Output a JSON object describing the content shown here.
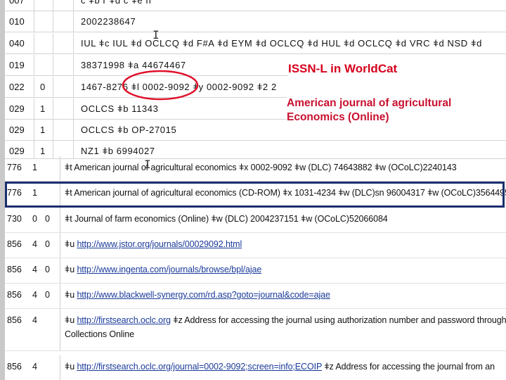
{
  "upper_rows": [
    {
      "tag": "007",
      "i1": "",
      "i2": "",
      "value": "c ǂb r ǂd c ǂe n"
    },
    {
      "tag": "010",
      "i1": "",
      "i2": "",
      "value": "2002238647"
    },
    {
      "tag": "040",
      "i1": "",
      "i2": "",
      "value": "IUL ǂc IUL ǂd OCLCQ ǂd F#A ǂd EYM ǂd OCLCQ ǂd HUL ǂd OCLCQ ǂd VRC ǂd NSD ǂd"
    },
    {
      "tag": "019",
      "i1": "",
      "i2": "",
      "value": "38371998 ǂa 44674467"
    },
    {
      "tag": "022",
      "i1": "0",
      "i2": "",
      "value": "1467-8276 ǂl 0002-9092 ǂy 0002-9092 ǂ2 2"
    },
    {
      "tag": "029",
      "i1": "1",
      "i2": "",
      "value": "OCLCS ǂb 11343"
    },
    {
      "tag": "029",
      "i1": "1",
      "i2": "",
      "value": "OCLCS ǂb OP-27015"
    },
    {
      "tag": "029",
      "i1": "1",
      "i2": "",
      "value": "NZ1 ǂb 6994027"
    }
  ],
  "lower_rows": [
    {
      "tag": "776",
      "i1": "1",
      "i2": "",
      "value": "ǂt American journal of agricultural economics ǂx 0002-9092 ǂw (DLC)   74643882 ǂw (OCoLC)2240143"
    },
    {
      "tag": "776",
      "i1": "1",
      "i2": "",
      "value": "ǂt American journal of agricultural economics (CD-ROM) ǂx 1031-4234 ǂw (DLC)sn 96004317 ǂw (OCoLC)35644954"
    },
    {
      "tag": "730",
      "i1": "0",
      "i2": "0",
      "value": "ǂt Journal of farm economics (Online) ǂw (DLC)   2004237151 ǂw (OCoLC)52066084"
    },
    {
      "tag": "856",
      "i1": "4",
      "i2": "0",
      "prefix": "ǂu ",
      "link": "http://www.jstor.org/journals/00029092.html",
      "suffix": "",
      "cont": ""
    },
    {
      "tag": "856",
      "i1": "4",
      "i2": "0",
      "prefix": "ǂu ",
      "link": "http://www.ingenta.com/journals/browse/bpl/ajae",
      "suffix": "",
      "cont": ""
    },
    {
      "tag": "856",
      "i1": "4",
      "i2": "0",
      "prefix": "ǂu ",
      "link": "http://www.blackwell-synergy.com/rd.asp?goto=journal&code=ajae",
      "suffix": "",
      "cont": ""
    },
    {
      "tag": "856",
      "i1": "4",
      "i2": "",
      "prefix": "ǂu ",
      "link": "http://firstsearch.oclc.org",
      "suffix": " ǂz Address for accessing the journal using authorization number and password through",
      "cont": "Collections Online"
    },
    {
      "tag": "856",
      "i1": "4",
      "i2": "",
      "prefix": "ǂu ",
      "link": "http://firstsearch.oclc.org/journal=0002-9092;screen=info;ECOIP",
      "suffix": " ǂz Address for accessing the journal from an",
      "cont": ""
    }
  ],
  "callouts": {
    "issn_l": "ISSN-L  in WorldCat",
    "title_line1": "American journal of agricultural",
    "title_line2": "Economics (Online)"
  },
  "colors": {
    "callout_red": "#d6001c",
    "ellipse_red": "#e0102a",
    "highlight_navy": "#1a2f6e",
    "link_blue": "#1a3a9a"
  }
}
